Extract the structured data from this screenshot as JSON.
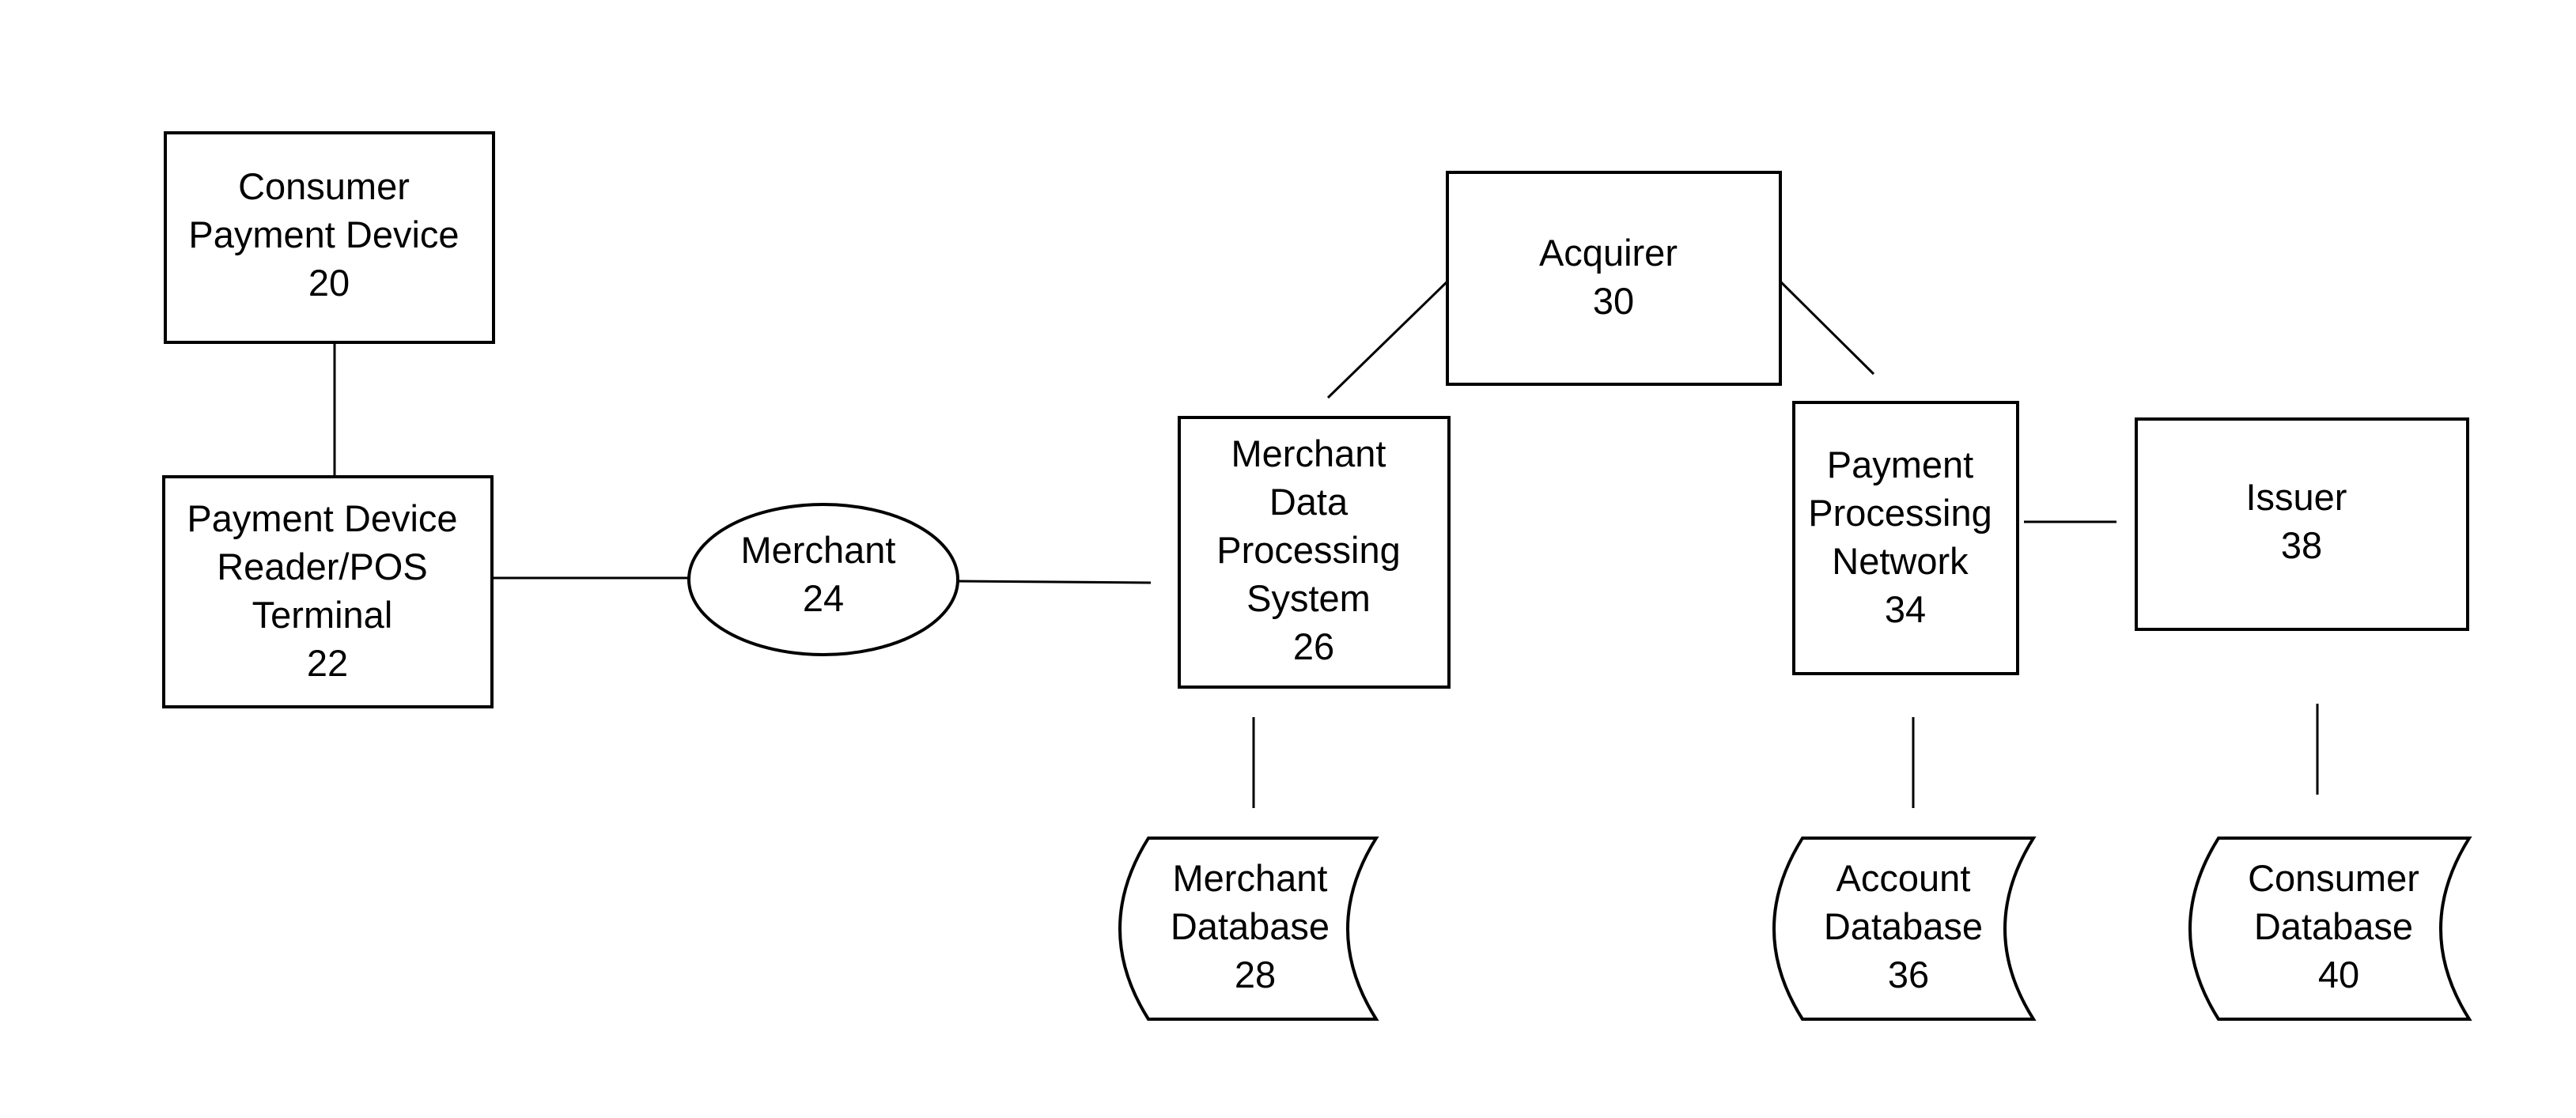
{
  "diagram": {
    "type": "block-diagram",
    "nodes": {
      "consumer_payment_device": {
        "shape": "rectangle",
        "lines": [
          "Consumer",
          "Payment Device",
          "20"
        ],
        "ref": "20"
      },
      "pos_terminal": {
        "shape": "rectangle",
        "lines": [
          "Payment Device",
          "Reader/POS",
          "Terminal",
          "22"
        ],
        "ref": "22"
      },
      "merchant": {
        "shape": "ellipse",
        "lines": [
          "Merchant",
          "24"
        ],
        "ref": "24"
      },
      "merchant_data_processing_system": {
        "shape": "rectangle",
        "lines": [
          "Merchant",
          "Data",
          "Processing",
          "System",
          "26"
        ],
        "ref": "26"
      },
      "merchant_database": {
        "shape": "stored-data",
        "lines": [
          "Merchant",
          "Database",
          "28"
        ],
        "ref": "28"
      },
      "acquirer": {
        "shape": "rectangle",
        "lines": [
          "Acquirer",
          "30"
        ],
        "ref": "30"
      },
      "payment_processing_network": {
        "shape": "rectangle",
        "lines": [
          "Payment",
          "Processing",
          "Network",
          "34"
        ],
        "ref": "34"
      },
      "account_database": {
        "shape": "stored-data",
        "lines": [
          "Account",
          "Database",
          "36"
        ],
        "ref": "36"
      },
      "issuer": {
        "shape": "rectangle",
        "lines": [
          "Issuer",
          "38"
        ],
        "ref": "38"
      },
      "consumer_database": {
        "shape": "stored-data",
        "lines": [
          "Consumer",
          "Database",
          "40"
        ],
        "ref": "40"
      }
    },
    "edges": [
      {
        "from": "consumer_payment_device",
        "to": "pos_terminal"
      },
      {
        "from": "pos_terminal",
        "to": "merchant"
      },
      {
        "from": "merchant",
        "to": "merchant_data_processing_system"
      },
      {
        "from": "merchant_data_processing_system",
        "to": "acquirer"
      },
      {
        "from": "acquirer",
        "to": "payment_processing_network"
      },
      {
        "from": "payment_processing_network",
        "to": "issuer"
      },
      {
        "from": "merchant_data_processing_system",
        "to": "merchant_database"
      },
      {
        "from": "payment_processing_network",
        "to": "account_database"
      },
      {
        "from": "issuer",
        "to": "consumer_database"
      }
    ],
    "colors": {
      "stroke": "#000000",
      "fill": "#ffffff",
      "text": "#000000"
    }
  }
}
